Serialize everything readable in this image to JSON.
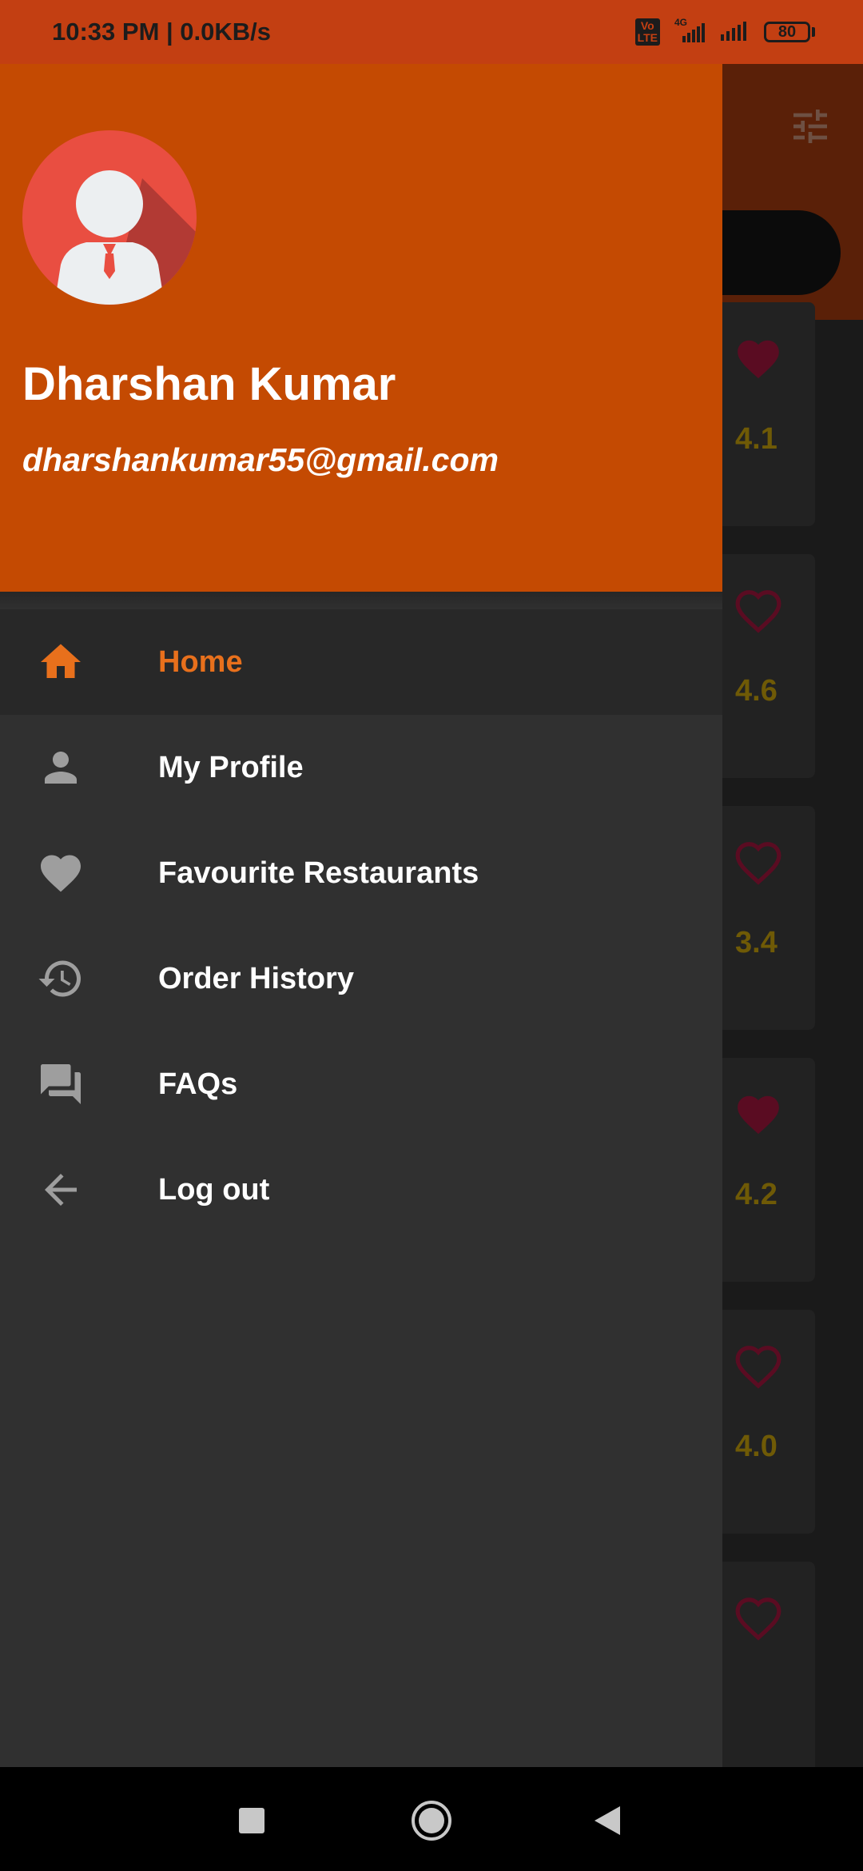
{
  "status_bar": {
    "time": "10:33 PM | 0.0KB/s",
    "volte_label": "Vo LTE",
    "network": "4G",
    "battery": "80"
  },
  "drawer": {
    "user_name": "Dharshan Kumar",
    "user_email": "dharshankumar55@gmail.com",
    "menu": [
      {
        "label": "Home",
        "icon": "home-icon",
        "active": true
      },
      {
        "label": "My Profile",
        "icon": "person-icon",
        "active": false
      },
      {
        "label": "Favourite Restaurants",
        "icon": "heart-icon",
        "active": false
      },
      {
        "label": "Order History",
        "icon": "history-icon",
        "active": false
      },
      {
        "label": "FAQs",
        "icon": "forum-icon",
        "active": false
      },
      {
        "label": "Log out",
        "icon": "arrow-back-icon",
        "active": false
      }
    ]
  },
  "background_list": {
    "ratings": [
      "4.1",
      "4.6",
      "3.4",
      "4.2",
      "4.0"
    ],
    "favourites": [
      true,
      false,
      false,
      true,
      false,
      false
    ]
  },
  "colors": {
    "accent": "#c44a02",
    "active_text": "#e8701c",
    "drawer_bg": "#303030"
  }
}
